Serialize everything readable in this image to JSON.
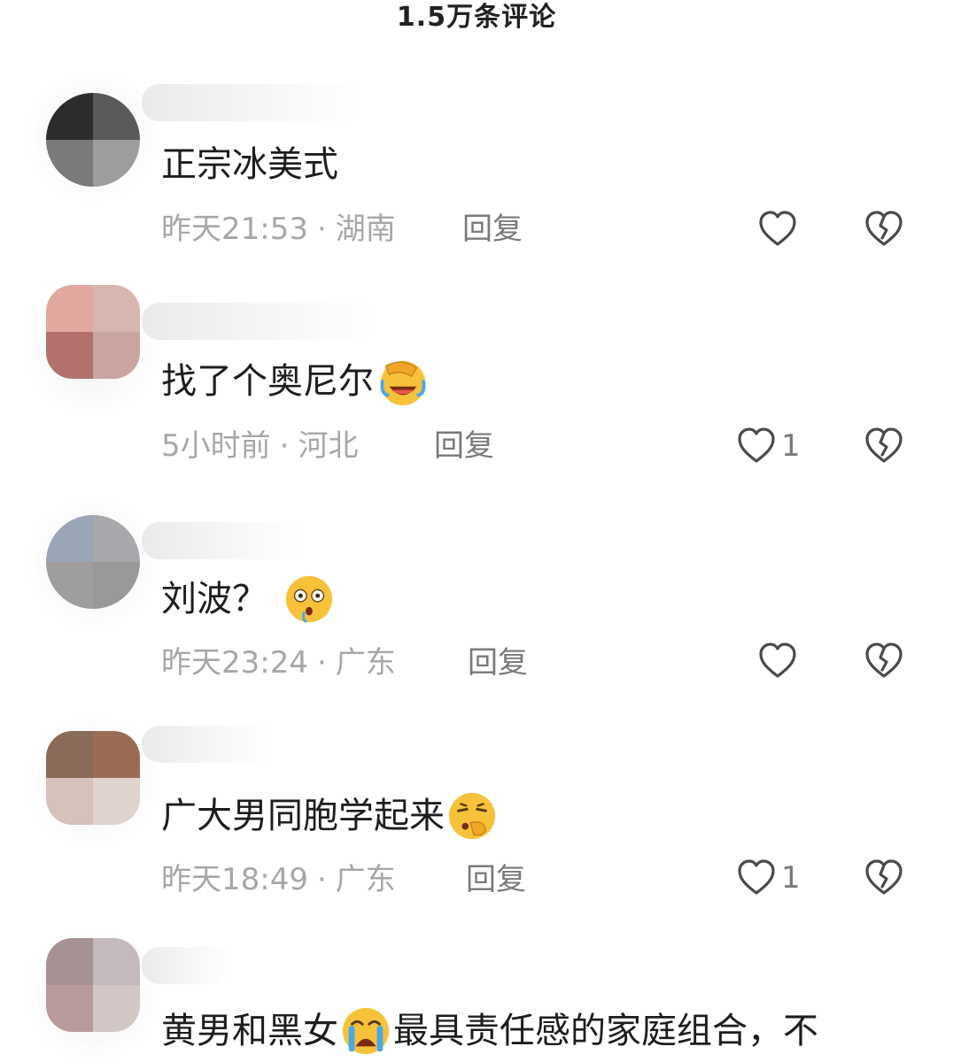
{
  "header": {
    "title": "1.5万条评论"
  },
  "colors": {
    "meta_text": "#a7a7a7",
    "reply_text": "#7a7a7a",
    "icon_stroke": "#4a4a4a",
    "emoji_yellow": "#f7c23a"
  },
  "comments": [
    {
      "text": "正宗冰美式",
      "emoji": "",
      "time": "昨天21:53",
      "location": "湖南",
      "reply_label": "回复",
      "like_count": "",
      "like_icon": "heart-outline-icon",
      "dislike_icon": "broken-heart-icon"
    },
    {
      "text": "找了个奥尼尔",
      "emoji": "face-palm-laugh-emoji",
      "time": "5小时前",
      "location": "河北",
      "reply_label": "回复",
      "like_count": "1",
      "like_icon": "heart-outline-icon",
      "dislike_icon": "broken-heart-icon"
    },
    {
      "text": "刘波？",
      "emoji": "shocked-face-emoji",
      "time": "昨天23:24",
      "location": "广东",
      "reply_label": "回复",
      "like_count": "",
      "like_icon": "heart-outline-icon",
      "dislike_icon": "broken-heart-icon"
    },
    {
      "text": "广大男同胞学起来",
      "emoji": "thinking-face-emoji",
      "time": "昨天18:49",
      "location": "广东",
      "reply_label": "回复",
      "like_count": "1",
      "like_icon": "heart-outline-icon",
      "dislike_icon": "broken-heart-icon"
    },
    {
      "text": "黄男和黑女",
      "emoji": "crying-face-emoji",
      "text_after": "最具责任感的家庭组合，不"
    }
  ]
}
